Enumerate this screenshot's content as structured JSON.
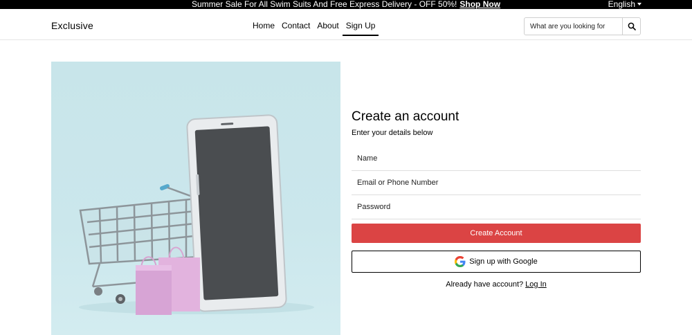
{
  "topbar": {
    "promo_text": "Summer Sale For All Swim Suits And Free Express Delivery - OFF 50%!",
    "promo_link": "Shop Now",
    "language": "English"
  },
  "header": {
    "logo": "Exclusive",
    "nav": [
      {
        "label": "Home",
        "active": false
      },
      {
        "label": "Contact",
        "active": false
      },
      {
        "label": "About",
        "active": false
      },
      {
        "label": "Sign Up",
        "active": true
      }
    ],
    "search_placeholder": "What are you looking for",
    "search_icon": "search-icon"
  },
  "hero": {
    "icons": [
      "shopping-cart-icon",
      "smartphone-icon",
      "shopping-bag-icon"
    ]
  },
  "form": {
    "title": "Create an account",
    "subtitle": "Enter your details below",
    "fields": {
      "name_placeholder": "Name",
      "email_placeholder": "Email or Phone Number",
      "password_placeholder": "Password"
    },
    "create_label": "Create Account",
    "google_label": "Sign up with Google",
    "login_prompt": "Already have account?",
    "login_link": "Log In"
  },
  "colors": {
    "accent": "#DB4444",
    "topbar": "#000000",
    "hero_bg": "#C8E5EA"
  }
}
